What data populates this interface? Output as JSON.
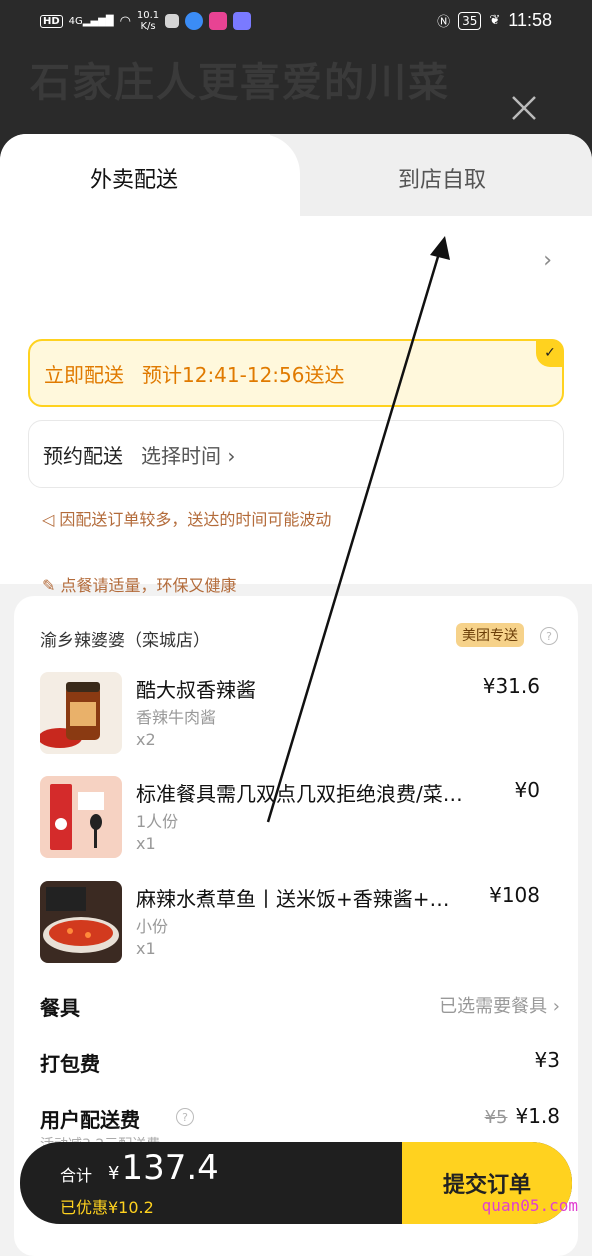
{
  "statusbar": {
    "network": "HD",
    "signal": "4G",
    "speed_top": "10.1",
    "speed_bottom": "K/s",
    "battery": "35",
    "time": "11:58"
  },
  "background_title": "石家庄人更喜爱的川菜",
  "tabs": [
    {
      "label": "外卖配送"
    },
    {
      "label": "到店自取"
    }
  ],
  "delivery_options": {
    "now_label": "立即配送",
    "now_time": "预计12:41-12:56送达",
    "schedule_label": "预约配送",
    "schedule_pick": "选择时间"
  },
  "notices": [
    "因配送订单较多，送达的时间可能波动",
    "点餐请适量，环保又健康"
  ],
  "shop": {
    "name": "渝乡辣婆婆（栾城店）",
    "delivery_badge": "美团专送"
  },
  "items": [
    {
      "name": "酷大叔香辣酱",
      "spec": "香辣牛肉酱",
      "qty": "x2",
      "price": "¥31.6"
    },
    {
      "name": "标准餐具需几双点几双拒绝浪费/菜品…",
      "spec": "1人份",
      "qty": "x1",
      "price": "¥0"
    },
    {
      "name": "麻辣水煮草鱼丨送米饭+香辣酱+…",
      "spec": "小份",
      "qty": "x1",
      "price": "¥108"
    }
  ],
  "fees": {
    "tableware_label": "餐具",
    "tableware_value": "已选需要餐具",
    "packing_label": "打包费",
    "packing_value": "¥3",
    "delivery_label": "用户配送费",
    "delivery_original": "¥5",
    "delivery_value": "¥1.8",
    "delivery_note": "活动减3.2元配送费"
  },
  "checkout": {
    "total_label": "合计",
    "currency": "¥",
    "total": "137.4",
    "discount": "已优惠¥10.2",
    "submit": "提交订单"
  },
  "watermark": "quan05.com",
  "colors": {
    "accent_yellow": "#ffd21f",
    "orange_text": "#e07a00",
    "dark_bar": "#1f1f1f"
  }
}
